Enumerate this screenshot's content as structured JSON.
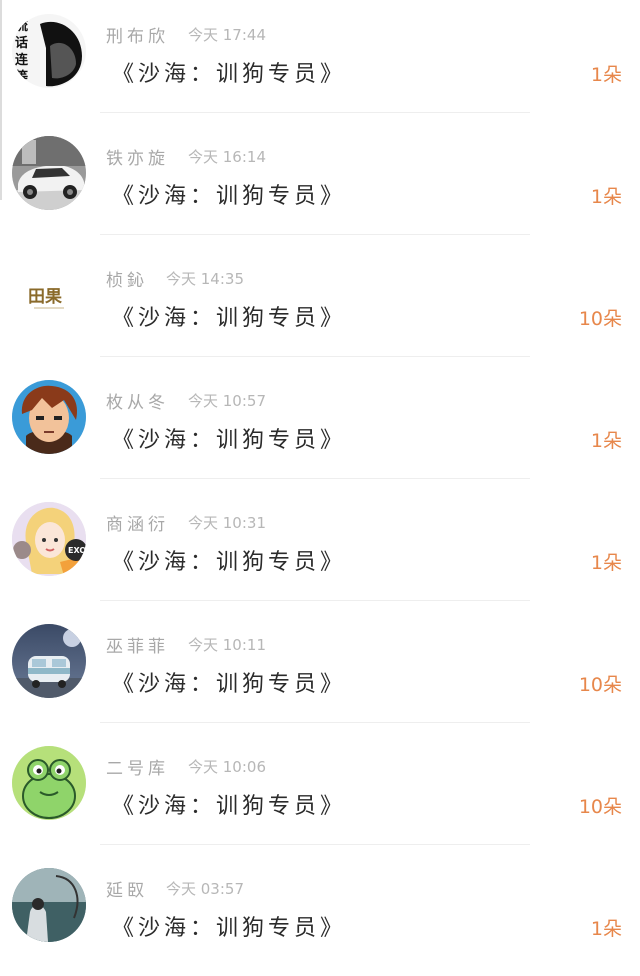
{
  "messages": [
    {
      "name": "刑布欣",
      "time": "今天 17:44",
      "text": "《沙海：训狗专员》",
      "count": "1朵",
      "avatar": "text-avatar-icon",
      "avatar_text": [
        "流",
        "话",
        "连",
        "等"
      ]
    },
    {
      "name": "铁亦旋",
      "time": "今天 16:14",
      "text": "《沙海：训狗专员》",
      "count": "1朵",
      "avatar": "car-avatar-icon"
    },
    {
      "name": "桢鈊",
      "time": "今天 14:35",
      "text": "《沙海：训狗专员》",
      "count": "10朵",
      "avatar": "logo-avatar-icon",
      "avatar_text": "田果"
    },
    {
      "name": "枚从冬",
      "time": "今天 10:57",
      "text": "《沙海：训狗专员》",
      "count": "1朵",
      "avatar": "anime-boy-avatar-icon"
    },
    {
      "name": "商涵衍",
      "time": "今天 10:31",
      "text": "《沙海：训狗专员》",
      "count": "1朵",
      "avatar": "anime-girl-avatar-icon",
      "avatar_text": "EXO"
    },
    {
      "name": "巫菲菲",
      "time": "今天 10:11",
      "text": "《沙海：训狗专员》",
      "count": "10朵",
      "avatar": "van-avatar-icon"
    },
    {
      "name": "二号库",
      "time": "今天 10:06",
      "text": "《沙海：训狗专员》",
      "count": "10朵",
      "avatar": "frog-avatar-icon"
    },
    {
      "name": "延臤",
      "time": "今天 03:57",
      "text": "《沙海：训狗专员》",
      "count": "1朵",
      "avatar": "photo-avatar-icon"
    }
  ],
  "colors": {
    "count": "#e7874b",
    "name": "#a8a8a8",
    "message": "#2b2b2b"
  }
}
